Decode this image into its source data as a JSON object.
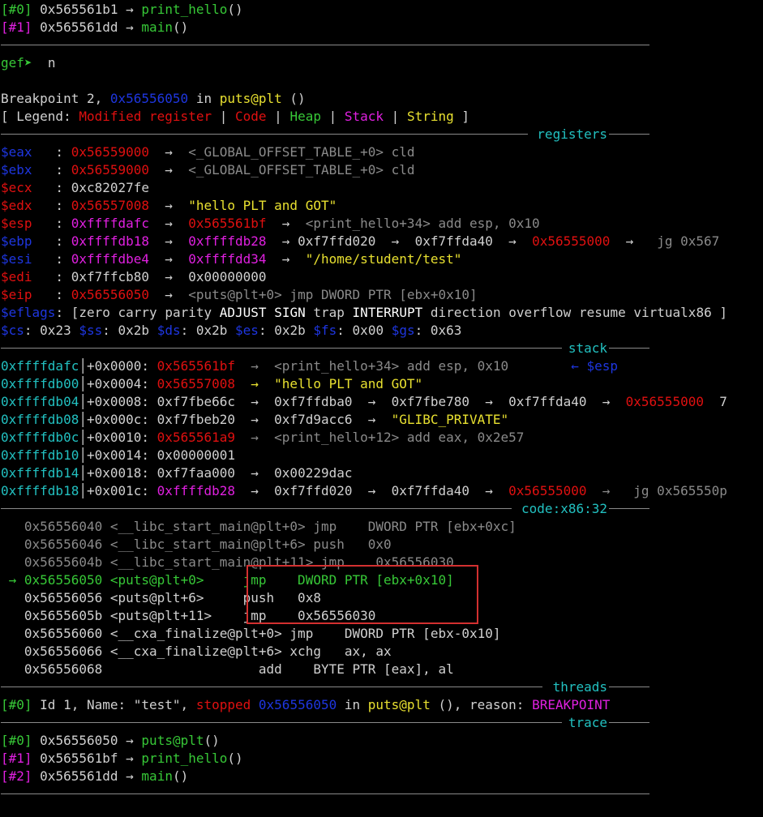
{
  "backtrace_top": [
    {
      "idx": "[#0]",
      "addr": "0x565561b1",
      "arrow": "→",
      "func": "print_hello",
      "paren": "()"
    },
    {
      "idx": "[#1]",
      "addr": "0x565561dd",
      "arrow": "→",
      "func": "main",
      "paren": "()"
    }
  ],
  "prompt": {
    "gef": "gef",
    "arrow": "➤",
    "cmd": "n"
  },
  "breakpoint": {
    "pre": "Breakpoint 2, ",
    "addr": "0x56556050",
    "mid": " in ",
    "func": "puts@plt",
    "post": " ()"
  },
  "legend": {
    "open": "[ Legend: ",
    "modified": "Modified register",
    "sep": " | ",
    "code": "Code",
    "heap": "Heap",
    "stack": "Stack",
    "string": "String",
    "close": " ]"
  },
  "section_titles": {
    "registers": "registers",
    "stack": "stack",
    "code": "code:x86:32",
    "threads": "threads",
    "trace": "trace"
  },
  "registers": {
    "eax": {
      "name": "$eax",
      "v": "0x56559000",
      "a": "→",
      "d": "<_GLOBAL_OFFSET_TABLE_+0> cld"
    },
    "ebx": {
      "name": "$ebx",
      "v": "0x56559000",
      "a": "→",
      "d": "<_GLOBAL_OFFSET_TABLE_+0> cld"
    },
    "ecx": {
      "name": "$ecx",
      "v": "0xc82027fe"
    },
    "edx": {
      "name": "$edx",
      "v": "0x56557008",
      "a": "→",
      "d": "\"hello PLT and GOT\""
    },
    "esp": {
      "name": "$esp",
      "v": "0xffffdafc",
      "a": "→",
      "v2": "0x565561bf",
      "a2": "→",
      "d": "<print_hello+34> add esp, 0x10"
    },
    "ebp": {
      "name": "$ebp",
      "v": "0xffffdb18",
      "a": "→",
      "v2": "0xffffdb28",
      "a2": "→",
      "v3": "0xf7ffd020",
      "a3": "→",
      "v4": "0xf7ffda40",
      "a4": "→",
      "v5": "0x56555000",
      "a5": "→",
      "d": "jg 0x567"
    },
    "esi": {
      "name": "$esi",
      "v": "0xffffdbe4",
      "a": "→",
      "v2": "0xffffdd34",
      "a2": "→",
      "d": "\"/home/student/test\""
    },
    "edi": {
      "name": "$edi",
      "v": "0xf7ffcb80",
      "a": "→",
      "v2": "0x00000000"
    },
    "eip": {
      "name": "$eip",
      "v": "0x56556050",
      "a": "→",
      "d": "<puts@plt+0> jmp DWORD PTR [ebx+0x10]"
    },
    "eflags": {
      "name": "$eflags",
      "open": ": [",
      "flags": [
        "zero",
        "carry",
        "parity",
        "ADJUST",
        "SIGN",
        "trap",
        "INTERRUPT",
        "direction",
        "overflow",
        "resume",
        "virtualx86"
      ],
      "close": " ]"
    },
    "segs": [
      {
        "name": "$cs",
        "v": "0x23"
      },
      {
        "name": "$ss",
        "v": "0x2b"
      },
      {
        "name": "$ds",
        "v": "0x2b"
      },
      {
        "name": "$es",
        "v": "0x2b"
      },
      {
        "name": "$fs",
        "v": "0x00"
      },
      {
        "name": "$gs",
        "v": "0x63"
      }
    ]
  },
  "stack": [
    {
      "addr": "0xffffdafc",
      "off": "+0x0000:",
      "v": "0x565561bf",
      "rest": "→  <print_hello+34> add esp, 0x10",
      "note": "← $esp"
    },
    {
      "addr": "0xffffdb00",
      "off": "+0x0004:",
      "v": "0x56557008",
      "rest": "→  \"hello PLT and GOT\""
    },
    {
      "addr": "0xffffdb04",
      "off": "+0x0008:",
      "v": "0xf7fbe66c",
      "rest": "→  0xf7ffdba0  →  0xf7fbe780  →  0xf7ffda40  →  ",
      "v2": "0x56555000",
      "rest2": "  7"
    },
    {
      "addr": "0xffffdb08",
      "off": "+0x000c:",
      "v": "0xf7fbeb20",
      "rest": "→  0xf7d9acc6  →  ",
      "str": "\"GLIBC_PRIVATE\""
    },
    {
      "addr": "0xffffdb0c",
      "off": "+0x0010:",
      "v": "0x565561a9",
      "rest": "→  <print_hello+12> add eax, 0x2e57"
    },
    {
      "addr": "0xffffdb10",
      "off": "+0x0014:",
      "v": "0x00000001"
    },
    {
      "addr": "0xffffdb14",
      "off": "+0x0018:",
      "v": "0xf7faa000",
      "rest": "→  0x00229dac"
    },
    {
      "addr": "0xffffdb18",
      "off": "+0x001c:",
      "v": "0xffffdb28",
      "rest": "→  0xf7ffd020  →  0xf7ffda40  →  ",
      "v2": "0x56555000",
      "rest2": "  →   jg 0x565550p"
    }
  ],
  "code": [
    {
      "mark": "   ",
      "text": "0x56556040 <__libc_start_main@plt+0> jmp    DWORD PTR [ebx+0xc]"
    },
    {
      "mark": "   ",
      "text": "0x56556046 <__libc_start_main@plt+6> push   0x0"
    },
    {
      "mark": "   ",
      "text": "0x5655604b <__libc_start_main@plt+11> jmp    0x56556030"
    },
    {
      "mark": " → ",
      "text": "0x56556050 <puts@plt+0>     jmp    DWORD PTR [ebx+0x10]"
    },
    {
      "mark": "   ",
      "text": "0x56556056 <puts@plt+6>     push   0x8"
    },
    {
      "mark": "   ",
      "text": "0x5655605b <puts@plt+11>    jmp    0x56556030"
    },
    {
      "mark": "   ",
      "text": "0x56556060 <__cxa_finalize@plt+0> jmp    DWORD PTR [ebx-0x10]"
    },
    {
      "mark": "   ",
      "text": "0x56556066 <__cxa_finalize@plt+6> xchg   ax, ax"
    },
    {
      "mark": "   ",
      "text": "0x56556068                    add    BYTE PTR [eax], al"
    }
  ],
  "thread": {
    "idx": "[#0]",
    "pre": " Id 1, Name: \"test\", ",
    "state": "stopped",
    "addr": "0x56556050",
    "mid": " in ",
    "func": "puts@plt",
    "post": " (), reason: ",
    "reason": "BREAKPOINT"
  },
  "trace": [
    {
      "idx": "[#0]",
      "addr": "0x56556050",
      "arrow": "→",
      "func": "puts@plt",
      "paren": "()"
    },
    {
      "idx": "[#1]",
      "addr": "0x565561bf",
      "arrow": "→",
      "func": "print_hello",
      "paren": "()"
    },
    {
      "idx": "[#2]",
      "addr": "0x565561dd",
      "arrow": "→",
      "func": "main",
      "paren": "()"
    }
  ]
}
